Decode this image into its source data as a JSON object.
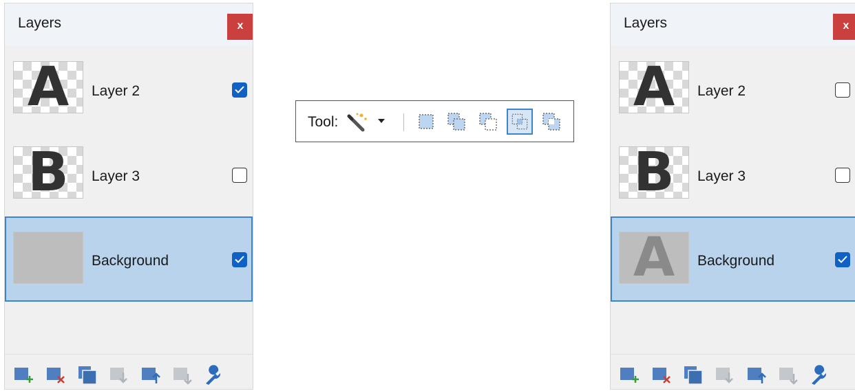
{
  "left_panel": {
    "title": "Layers",
    "close_label": "x",
    "layers": [
      {
        "thumb_text": "A",
        "name": "Layer 2",
        "visible": true,
        "selected": false
      },
      {
        "thumb_text": "B",
        "name": "Layer 3",
        "visible": false,
        "selected": false
      },
      {
        "thumb_text": "",
        "name": "Background",
        "visible": true,
        "selected": true
      }
    ]
  },
  "right_panel": {
    "title": "Layers",
    "close_label": "x",
    "layers": [
      {
        "thumb_text": "A",
        "name": "Layer 2",
        "visible": false,
        "selected": false
      },
      {
        "thumb_text": "B",
        "name": "Layer 3",
        "visible": false,
        "selected": false
      },
      {
        "thumb_text": "A",
        "name": "Background",
        "visible": true,
        "selected": true
      }
    ]
  },
  "bottom_toolbar_icons": [
    "add-layer-icon",
    "delete-layer-icon",
    "duplicate-layer-icon",
    "merge-layer-down-icon",
    "move-layer-up-icon",
    "move-layer-down-icon",
    "layer-properties-icon"
  ],
  "tool_strip": {
    "label": "Tool:",
    "tool_icon": "magic-wand-icon",
    "selection_modes": [
      "replace-selection-icon",
      "union-selection-icon",
      "exclude-selection-icon",
      "intersect-selection-icon",
      "xor-selection-icon"
    ],
    "active_mode": "intersect-selection-icon"
  },
  "colors": {
    "selected_row": "#b9d3ec",
    "selected_border": "#3d84cf",
    "close_button": "#c9403f",
    "checkbox_on": "#0f62c4"
  }
}
